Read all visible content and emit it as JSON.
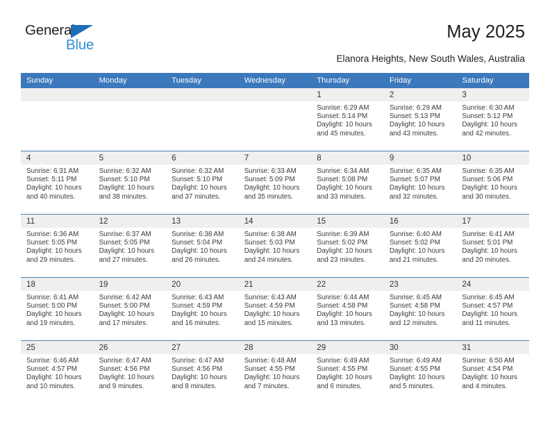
{
  "brand": {
    "name_top": "General",
    "name_bottom": "Blue",
    "triangle_color": "#1d6fb7",
    "blue_color": "#2e8fd6"
  },
  "header": {
    "title": "May 2025",
    "subtitle": "Elanora Heights, New South Wales, Australia"
  },
  "theme": {
    "header_bg": "#3c78bc",
    "daynum_bg": "#efefef",
    "row_border": "#4a7fb5"
  },
  "weekday_headers": [
    "Sunday",
    "Monday",
    "Tuesday",
    "Wednesday",
    "Thursday",
    "Friday",
    "Saturday"
  ],
  "weeks": [
    [
      {
        "day": "",
        "sunrise": "",
        "sunset": "",
        "daylight1": "",
        "daylight2": ""
      },
      {
        "day": "",
        "sunrise": "",
        "sunset": "",
        "daylight1": "",
        "daylight2": ""
      },
      {
        "day": "",
        "sunrise": "",
        "sunset": "",
        "daylight1": "",
        "daylight2": ""
      },
      {
        "day": "",
        "sunrise": "",
        "sunset": "",
        "daylight1": "",
        "daylight2": ""
      },
      {
        "day": "1",
        "sunrise": "Sunrise: 6:29 AM",
        "sunset": "Sunset: 5:14 PM",
        "daylight1": "Daylight: 10 hours",
        "daylight2": "and 45 minutes."
      },
      {
        "day": "2",
        "sunrise": "Sunrise: 6:29 AM",
        "sunset": "Sunset: 5:13 PM",
        "daylight1": "Daylight: 10 hours",
        "daylight2": "and 43 minutes."
      },
      {
        "day": "3",
        "sunrise": "Sunrise: 6:30 AM",
        "sunset": "Sunset: 5:12 PM",
        "daylight1": "Daylight: 10 hours",
        "daylight2": "and 42 minutes."
      }
    ],
    [
      {
        "day": "4",
        "sunrise": "Sunrise: 6:31 AM",
        "sunset": "Sunset: 5:11 PM",
        "daylight1": "Daylight: 10 hours",
        "daylight2": "and 40 minutes."
      },
      {
        "day": "5",
        "sunrise": "Sunrise: 6:32 AM",
        "sunset": "Sunset: 5:10 PM",
        "daylight1": "Daylight: 10 hours",
        "daylight2": "and 38 minutes."
      },
      {
        "day": "6",
        "sunrise": "Sunrise: 6:32 AM",
        "sunset": "Sunset: 5:10 PM",
        "daylight1": "Daylight: 10 hours",
        "daylight2": "and 37 minutes."
      },
      {
        "day": "7",
        "sunrise": "Sunrise: 6:33 AM",
        "sunset": "Sunset: 5:09 PM",
        "daylight1": "Daylight: 10 hours",
        "daylight2": "and 35 minutes."
      },
      {
        "day": "8",
        "sunrise": "Sunrise: 6:34 AM",
        "sunset": "Sunset: 5:08 PM",
        "daylight1": "Daylight: 10 hours",
        "daylight2": "and 33 minutes."
      },
      {
        "day": "9",
        "sunrise": "Sunrise: 6:35 AM",
        "sunset": "Sunset: 5:07 PM",
        "daylight1": "Daylight: 10 hours",
        "daylight2": "and 32 minutes."
      },
      {
        "day": "10",
        "sunrise": "Sunrise: 6:35 AM",
        "sunset": "Sunset: 5:06 PM",
        "daylight1": "Daylight: 10 hours",
        "daylight2": "and 30 minutes."
      }
    ],
    [
      {
        "day": "11",
        "sunrise": "Sunrise: 6:36 AM",
        "sunset": "Sunset: 5:05 PM",
        "daylight1": "Daylight: 10 hours",
        "daylight2": "and 29 minutes."
      },
      {
        "day": "12",
        "sunrise": "Sunrise: 6:37 AM",
        "sunset": "Sunset: 5:05 PM",
        "daylight1": "Daylight: 10 hours",
        "daylight2": "and 27 minutes."
      },
      {
        "day": "13",
        "sunrise": "Sunrise: 6:38 AM",
        "sunset": "Sunset: 5:04 PM",
        "daylight1": "Daylight: 10 hours",
        "daylight2": "and 26 minutes."
      },
      {
        "day": "14",
        "sunrise": "Sunrise: 6:38 AM",
        "sunset": "Sunset: 5:03 PM",
        "daylight1": "Daylight: 10 hours",
        "daylight2": "and 24 minutes."
      },
      {
        "day": "15",
        "sunrise": "Sunrise: 6:39 AM",
        "sunset": "Sunset: 5:02 PM",
        "daylight1": "Daylight: 10 hours",
        "daylight2": "and 23 minutes."
      },
      {
        "day": "16",
        "sunrise": "Sunrise: 6:40 AM",
        "sunset": "Sunset: 5:02 PM",
        "daylight1": "Daylight: 10 hours",
        "daylight2": "and 21 minutes."
      },
      {
        "day": "17",
        "sunrise": "Sunrise: 6:41 AM",
        "sunset": "Sunset: 5:01 PM",
        "daylight1": "Daylight: 10 hours",
        "daylight2": "and 20 minutes."
      }
    ],
    [
      {
        "day": "18",
        "sunrise": "Sunrise: 6:41 AM",
        "sunset": "Sunset: 5:00 PM",
        "daylight1": "Daylight: 10 hours",
        "daylight2": "and 19 minutes."
      },
      {
        "day": "19",
        "sunrise": "Sunrise: 6:42 AM",
        "sunset": "Sunset: 5:00 PM",
        "daylight1": "Daylight: 10 hours",
        "daylight2": "and 17 minutes."
      },
      {
        "day": "20",
        "sunrise": "Sunrise: 6:43 AM",
        "sunset": "Sunset: 4:59 PM",
        "daylight1": "Daylight: 10 hours",
        "daylight2": "and 16 minutes."
      },
      {
        "day": "21",
        "sunrise": "Sunrise: 6:43 AM",
        "sunset": "Sunset: 4:59 PM",
        "daylight1": "Daylight: 10 hours",
        "daylight2": "and 15 minutes."
      },
      {
        "day": "22",
        "sunrise": "Sunrise: 6:44 AM",
        "sunset": "Sunset: 4:58 PM",
        "daylight1": "Daylight: 10 hours",
        "daylight2": "and 13 minutes."
      },
      {
        "day": "23",
        "sunrise": "Sunrise: 6:45 AM",
        "sunset": "Sunset: 4:58 PM",
        "daylight1": "Daylight: 10 hours",
        "daylight2": "and 12 minutes."
      },
      {
        "day": "24",
        "sunrise": "Sunrise: 6:45 AM",
        "sunset": "Sunset: 4:57 PM",
        "daylight1": "Daylight: 10 hours",
        "daylight2": "and 11 minutes."
      }
    ],
    [
      {
        "day": "25",
        "sunrise": "Sunrise: 6:46 AM",
        "sunset": "Sunset: 4:57 PM",
        "daylight1": "Daylight: 10 hours",
        "daylight2": "and 10 minutes."
      },
      {
        "day": "26",
        "sunrise": "Sunrise: 6:47 AM",
        "sunset": "Sunset: 4:56 PM",
        "daylight1": "Daylight: 10 hours",
        "daylight2": "and 9 minutes."
      },
      {
        "day": "27",
        "sunrise": "Sunrise: 6:47 AM",
        "sunset": "Sunset: 4:56 PM",
        "daylight1": "Daylight: 10 hours",
        "daylight2": "and 8 minutes."
      },
      {
        "day": "28",
        "sunrise": "Sunrise: 6:48 AM",
        "sunset": "Sunset: 4:55 PM",
        "daylight1": "Daylight: 10 hours",
        "daylight2": "and 7 minutes."
      },
      {
        "day": "29",
        "sunrise": "Sunrise: 6:49 AM",
        "sunset": "Sunset: 4:55 PM",
        "daylight1": "Daylight: 10 hours",
        "daylight2": "and 6 minutes."
      },
      {
        "day": "30",
        "sunrise": "Sunrise: 6:49 AM",
        "sunset": "Sunset: 4:55 PM",
        "daylight1": "Daylight: 10 hours",
        "daylight2": "and 5 minutes."
      },
      {
        "day": "31",
        "sunrise": "Sunrise: 6:50 AM",
        "sunset": "Sunset: 4:54 PM",
        "daylight1": "Daylight: 10 hours",
        "daylight2": "and 4 minutes."
      }
    ]
  ]
}
